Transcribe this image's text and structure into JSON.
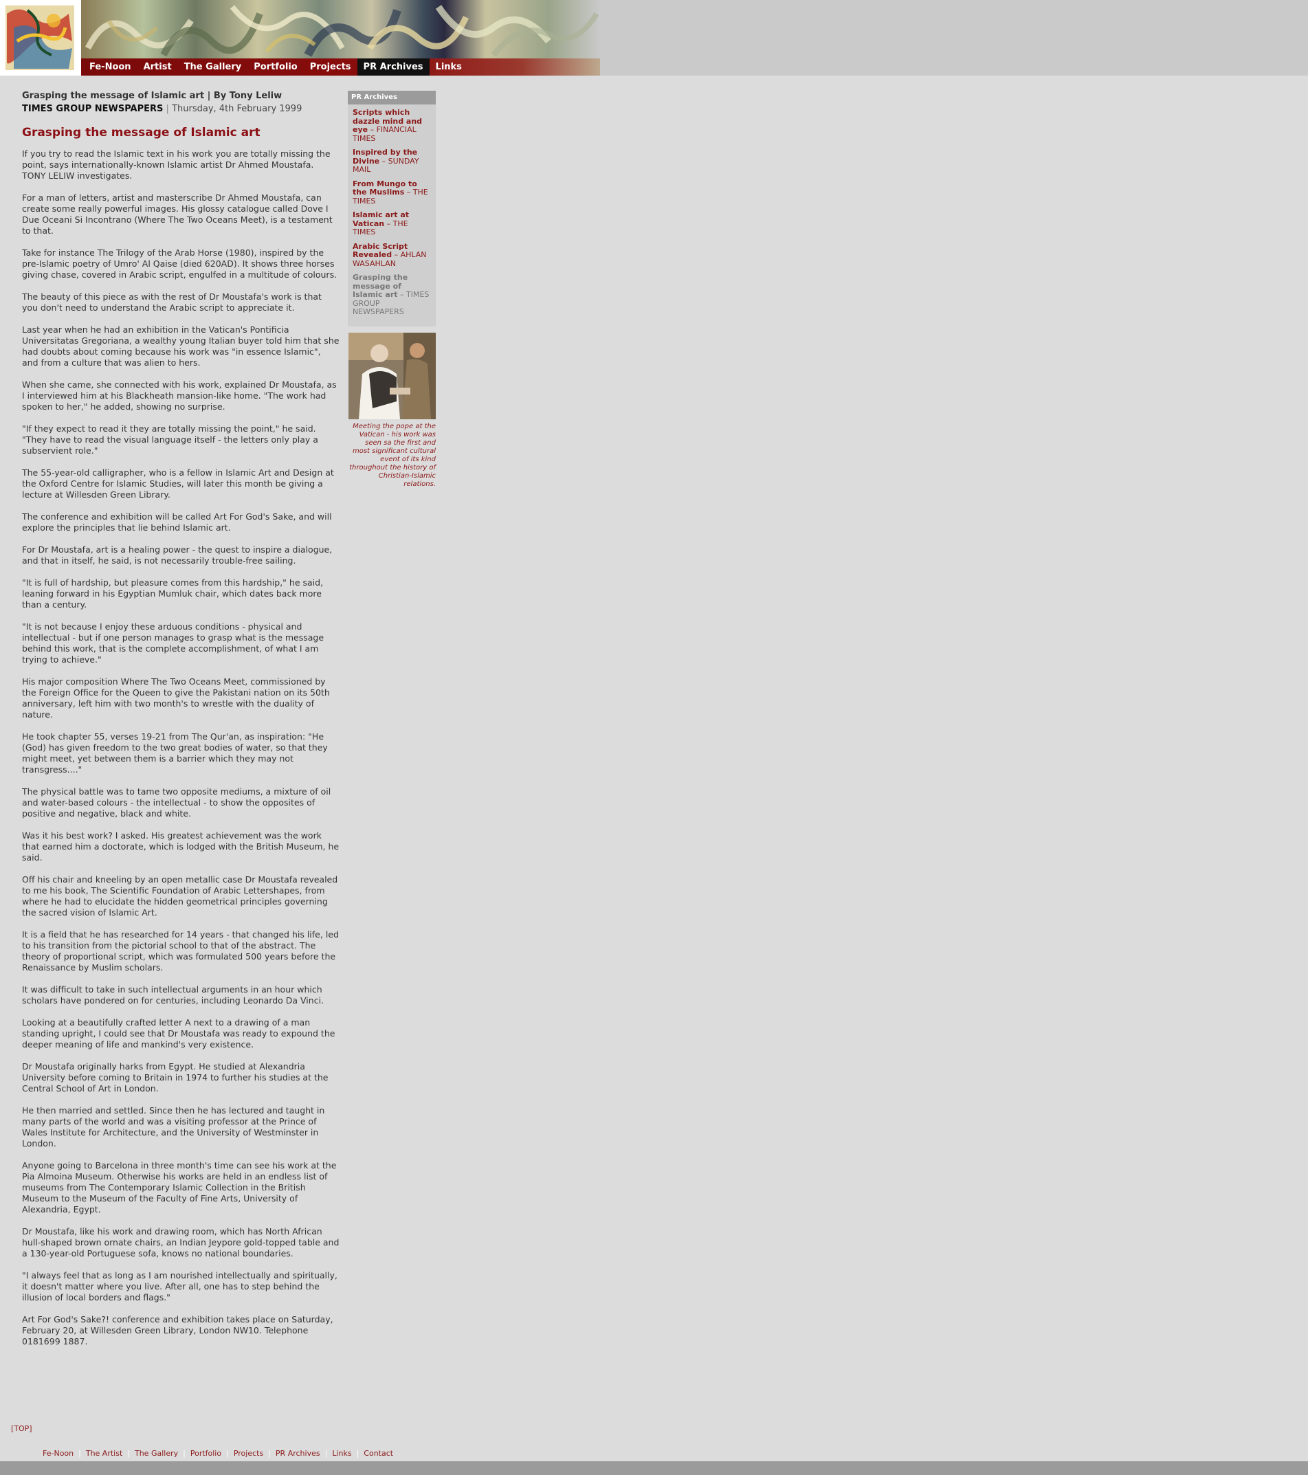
{
  "nav": {
    "items": [
      "Fe-Noon",
      "Artist",
      "The Gallery",
      "Portfolio",
      "Projects",
      "PR Archives",
      "Links"
    ],
    "active": "PR Archives"
  },
  "article": {
    "byline_title": "Grasping the message of Islamic art | By Tony Leliw",
    "source_name": "TIMES GROUP NEWSPAPERS",
    "source_sep": "|",
    "date": "Thursday, 4th February 1999",
    "headline": "Grasping the message of Islamic art",
    "paragraphs": [
      "If you try to read the Islamic text in his work you are totally missing the point, says internationally-known Islamic artist Dr Ahmed Moustafa. TONY LELIW investigates.",
      "For a man of letters, artist and masterscribe Dr Ahmed Moustafa, can create some really powerful images. His glossy catalogue called Dove I Due Oceani Si Incontrano (Where The Two Oceans Meet), is a testament to that.",
      "Take for instance The Trilogy of the Arab Horse (1980), inspired by the pre-Islamic poetry of Umro' Al Qaise (died 620AD). It shows three horses giving chase, covered in Arabic script, engulfed in a multitude of colours.",
      "The beauty of this piece as with the rest of Dr Moustafa's work is that you don't need to understand the Arabic script to appreciate it.",
      "Last year when he had an exhibition in the Vatican's Pontificia Universitatas Gregoriana, a wealthy young Italian buyer told him that she had doubts about coming because his work was \"in essence Islamic\", and from a culture that was alien to hers.",
      "When she came, she connected with his work, explained Dr Moustafa, as I interviewed him at his Blackheath mansion-like home. \"The work had spoken to her,\" he added, showing no surprise.",
      "\"If they expect to read it they are totally missing the point,\" he said. \"They have to read the visual language itself - the letters only play a subservient role.\"",
      "The 55-year-old calligrapher, who is a fellow in Islamic Art and Design at the Oxford Centre for Islamic Studies, will later this month be giving a lecture at Willesden Green Library.",
      "The conference and exhibition will be called Art For God's Sake, and will explore the principles that lie behind Islamic art.",
      "For Dr Moustafa, art is a healing power - the quest to inspire a dialogue, and that in itself, he said, is not necessarily trouble-free sailing.",
      "\"It is full of hardship, but pleasure comes from this hardship,\" he said, leaning forward in his Egyptian Mumluk chair, which dates back more than a century.",
      "\"It is not because I enjoy these arduous conditions - physical and intellectual - but if one person manages to grasp what is the message behind this work, that is the complete accomplishment, of what I am trying to achieve.\"",
      "His major composition Where The Two Oceans Meet, commissioned by the Foreign Office for the Queen to give the Pakistani nation on its 50th anniversary, left him with two month's to wrestle with the duality of nature.",
      "He took chapter 55, verses 19-21 from The Qur'an, as inspiration: \"He (God) has given freedom to the two great bodies of water, so that they might meet, yet between them is a barrier which they may not transgress....\"",
      "The physical battle was to tame two opposite mediums, a mixture of oil and water-based colours - the intellectual - to show the opposites of positive and negative, black and white.",
      "Was it his best work? I asked. His greatest achievement was the work that earned him a doctorate, which is lodged with the British Museum, he said.",
      "Off his chair and kneeling by an open metallic case Dr Moustafa revealed to me his book, The Scientific Foundation of Arabic Lettershapes, from where he had to elucidate the hidden geometrical principles governing the sacred vision of Islamic Art.",
      "It is a field that he has researched for 14 years - that changed his life, led to his transition from the pictorial school to that of the abstract. The theory of proportional script, which was formulated 500 years before the Renaissance by Muslim scholars.",
      "It was difficult to take in such intellectual arguments in an hour which scholars have pondered on for centuries, including Leonardo Da Vinci.",
      "Looking at a beautifully crafted letter A next to a drawing of a man standing upright, I could see that Dr Moustafa was ready to expound the deeper meaning of life and mankind's very existence.",
      "Dr Moustafa originally harks from Egypt. He studied at Alexandria University before coming to Britain in 1974 to further his studies at the Central School of Art in London.",
      "He then married and settled. Since then he has lectured and taught in many parts of the world and was a visiting professor at the Prince of Wales Institute for Architecture, and the University of Westminster in London.",
      "Anyone going to Barcelona in three month's time can see his work at the Pia Almoina Museum. Otherwise his works are held in an endless list of museums from The Contemporary Islamic Collection in the British Museum to the Museum of the Faculty of Fine Arts, University of Alexandria, Egypt.",
      "Dr Moustafa, like his work and drawing room, which has North African hull-shaped brown ornate chairs, an Indian Jeypore gold-topped table and a 130-year-old Portuguese sofa, knows no national boundaries.",
      "\"I always feel that as long as I am nourished intellectually and spiritually, it doesn't matter where you live. After all, one has to step behind the illusion of local borders and flags.\"",
      "Art For God's Sake?! conference and exhibition takes place on Saturday, February 20, at Willesden Green Library, London NW10. Telephone 0181699 1887."
    ]
  },
  "sidebar": {
    "heading": "PR Archives",
    "items": [
      {
        "title": "Scripts which dazzle mind and eye",
        "dash": " – ",
        "source": "FINANCIAL TIMES"
      },
      {
        "title": "Inspired by the Divine",
        "dash": " – ",
        "source": "SUNDAY MAIL"
      },
      {
        "title": "From Mungo to the Muslims",
        "dash": " – ",
        "source": "THE TIMES"
      },
      {
        "title": "Islamic art at Vatican",
        "dash": " – ",
        "source": "THE TIMES"
      },
      {
        "title": "Arabic Script Revealed",
        "dash": " – ",
        "source": "AHLAN WASAHLAN"
      },
      {
        "title": "Grasping the message of Islamic art",
        "dash": " – ",
        "source": "TIMES GROUP NEWSPAPERS"
      }
    ],
    "caption": "Meeting the pope at the Vatican - his work was seen sa the first and most significant cultural event of its kind throughout the history of Christian-Islamic relations."
  },
  "footer": {
    "top_link": "[TOP]",
    "links": [
      "Fe-Noon",
      "The Artist",
      "The Gallery",
      "Portfolio",
      "Projects",
      "PR Archives",
      "Links",
      "Contact"
    ],
    "divider": "|"
  },
  "colors": {
    "accent_red": "#8b0f14",
    "nav_bg": "#7a0a0a",
    "page_bg": "#dcdcdc",
    "sidebar_head": "#9b9b9b"
  }
}
